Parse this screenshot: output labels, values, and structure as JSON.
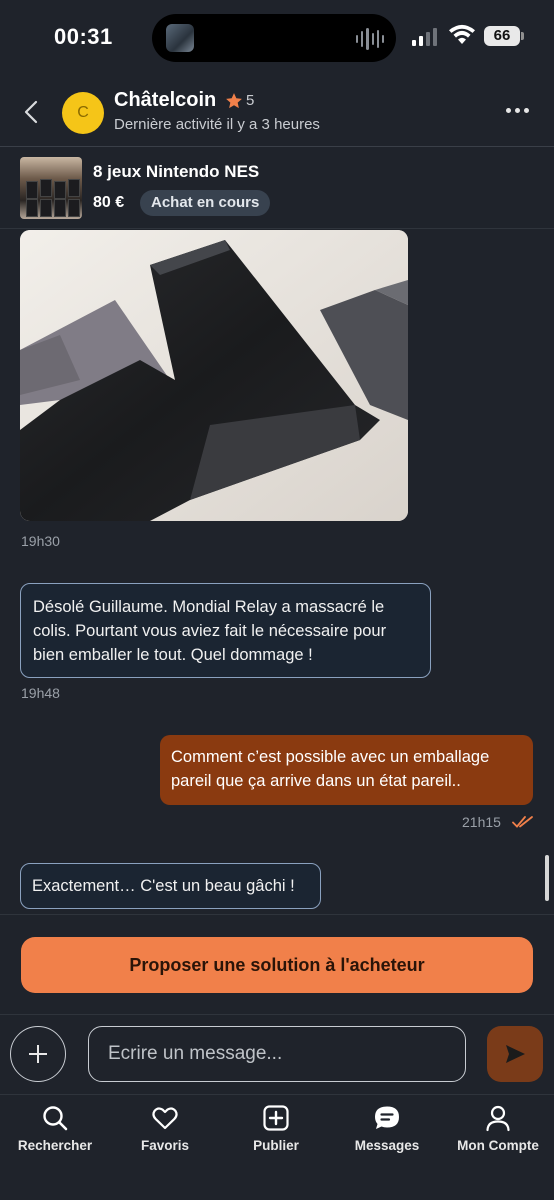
{
  "status_bar": {
    "time": "00:31",
    "battery": "66"
  },
  "header": {
    "avatar_letter": "C",
    "seller_name": "Châtelcoin",
    "rating": "5",
    "last_activity": "Dernière activité il y a 3 heures"
  },
  "product": {
    "title": "8 jeux Nintendo NES",
    "price": "80 €",
    "status": "Achat en cours"
  },
  "messages": [
    {
      "type": "image",
      "time": "19h30"
    },
    {
      "type": "incoming",
      "text": "Désolé Guillaume. Mondial Relay a massacré le colis. Pourtant vous aviez fait le nécessaire pour bien emballer le tout. Quel dommage !",
      "time": "19h48"
    },
    {
      "type": "outgoing",
      "text": "Comment c’est possible avec un emballage pareil que ça arrive dans un état pareil..",
      "time": "21h15"
    },
    {
      "type": "incoming",
      "text": "Exactement… C'est un beau gâchi !"
    }
  ],
  "actions": {
    "propose_label": "Proposer une solution à l'acheteur"
  },
  "composer": {
    "placeholder": "Ecrire un message..."
  },
  "tabbar": {
    "items": [
      {
        "label": "Rechercher",
        "icon": "search-icon"
      },
      {
        "label": "Favoris",
        "icon": "heart-icon"
      },
      {
        "label": "Publier",
        "icon": "plus-square-icon"
      },
      {
        "label": "Messages",
        "icon": "chat-icon"
      },
      {
        "label": "Mon Compte",
        "icon": "person-icon"
      }
    ]
  },
  "colors": {
    "background": "#1f232b",
    "accent": "#f1804a",
    "outgoing_bubble": "#8a3a10",
    "incoming_border": "#8aa1bf",
    "read_check": "#f1804a",
    "star": "#f1804a"
  }
}
